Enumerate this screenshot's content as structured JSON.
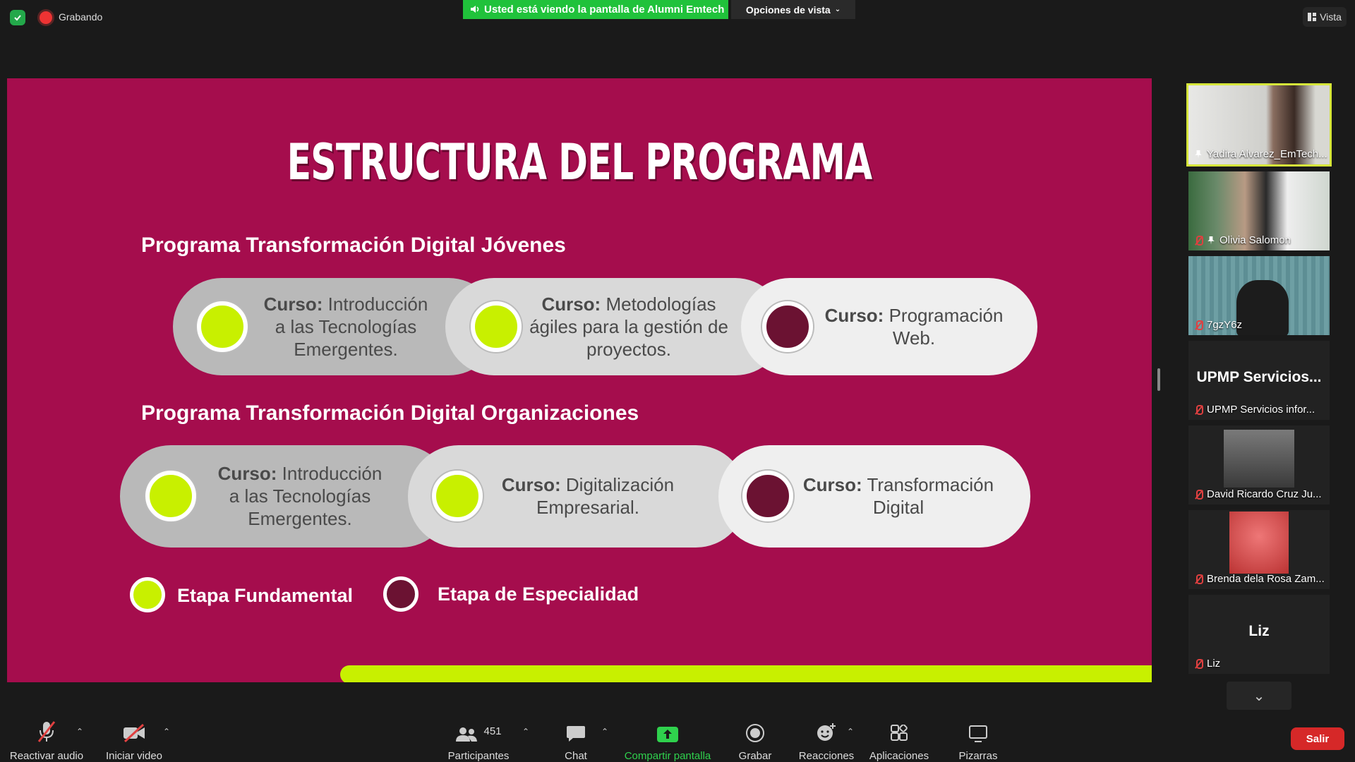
{
  "top": {
    "recording_label": "Grabando",
    "viewing_banner": "Usted está viendo la pantalla de Alumni Emtech",
    "view_options": "Opciones de vista",
    "view_button": "Vista"
  },
  "slide": {
    "title": "ESTRUCTURA DEL PROGRAMA",
    "sections": [
      {
        "title": "Programa Transformación Digital Jóvenes",
        "courses": [
          {
            "prefix": "Curso:",
            "text_lines": [
              "Introducción",
              "a las Tecnologías",
              "Emergentes."
            ],
            "stage": "fundamental"
          },
          {
            "prefix": "Curso:",
            "text_lines": [
              "Metodologías",
              "ágiles para la gestión de",
              "proyectos."
            ],
            "stage": "fundamental"
          },
          {
            "prefix": "Curso:",
            "text_lines": [
              "Programación",
              "Web."
            ],
            "stage": "especialidad"
          }
        ]
      },
      {
        "title": "Programa Transformación Digital Organizaciones",
        "courses": [
          {
            "prefix": "Curso:",
            "text_lines": [
              "Introducción",
              "a las Tecnologías",
              "Emergentes."
            ],
            "stage": "fundamental"
          },
          {
            "prefix": "Curso:",
            "text_lines": [
              "Digitalización",
              "Empresarial."
            ],
            "stage": "fundamental"
          },
          {
            "prefix": "Curso:",
            "text_lines": [
              "Transformación",
              "Digital"
            ],
            "stage": "especialidad"
          }
        ]
      }
    ],
    "legend": [
      {
        "label": "Etapa Fundamental",
        "color": "#c8f000"
      },
      {
        "label": "Etapa de Especialidad",
        "color": "#6b1232"
      }
    ]
  },
  "participants_panel": [
    {
      "name": "Yadira Alvarez_EmTech...",
      "active": true
    },
    {
      "name": "Olivia Salomon"
    },
    {
      "name": "7gzY6z"
    },
    {
      "name": "UPMP Servicios infor...",
      "display": "UPMP  Servicios..."
    },
    {
      "name": "David Ricardo Cruz Ju..."
    },
    {
      "name": "Brenda dela Rosa Zam..."
    },
    {
      "name": "Liz",
      "display": "Liz"
    }
  ],
  "toolbar": {
    "unmute": "Reactivar audio",
    "start_video": "Iniciar video",
    "participants": "Participantes",
    "participants_count": "451",
    "chat": "Chat",
    "share": "Compartir pantalla",
    "record": "Grabar",
    "reactions": "Reacciones",
    "apps": "Aplicaciones",
    "whiteboards": "Pizarras",
    "leave": "Salir"
  },
  "colors": {
    "slide_bg": "#a50d4d",
    "accent_green": "#c8f000",
    "accent_maroon": "#6b1232",
    "banner_green": "#20c23b",
    "leave_red": "#d62828"
  }
}
